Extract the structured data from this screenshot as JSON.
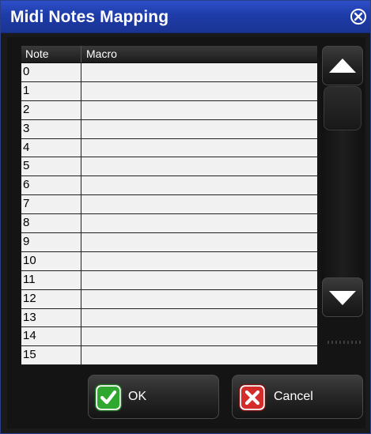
{
  "window": {
    "title": "Midi Notes Mapping"
  },
  "table": {
    "columns": [
      "Note",
      "Macro"
    ],
    "rows": [
      {
        "note": "0",
        "macro": ""
      },
      {
        "note": "1",
        "macro": ""
      },
      {
        "note": "2",
        "macro": ""
      },
      {
        "note": "3",
        "macro": ""
      },
      {
        "note": "4",
        "macro": ""
      },
      {
        "note": "5",
        "macro": ""
      },
      {
        "note": "6",
        "macro": ""
      },
      {
        "note": "7",
        "macro": ""
      },
      {
        "note": "8",
        "macro": ""
      },
      {
        "note": "9",
        "macro": ""
      },
      {
        "note": "10",
        "macro": ""
      },
      {
        "note": "11",
        "macro": ""
      },
      {
        "note": "12",
        "macro": ""
      },
      {
        "note": "13",
        "macro": ""
      },
      {
        "note": "14",
        "macro": ""
      },
      {
        "note": "15",
        "macro": ""
      }
    ]
  },
  "scrollbar": {
    "up_icon": "triangle-up-icon",
    "down_icon": "triangle-down-icon"
  },
  "buttons": {
    "ok_label": "OK",
    "ok_icon": "checkmark-icon",
    "cancel_label": "Cancel",
    "cancel_icon": "x-icon"
  },
  "colors": {
    "titlebar": "#1e3ca8",
    "ok_icon": "#2fa82f",
    "cancel_icon": "#d42b2b"
  }
}
